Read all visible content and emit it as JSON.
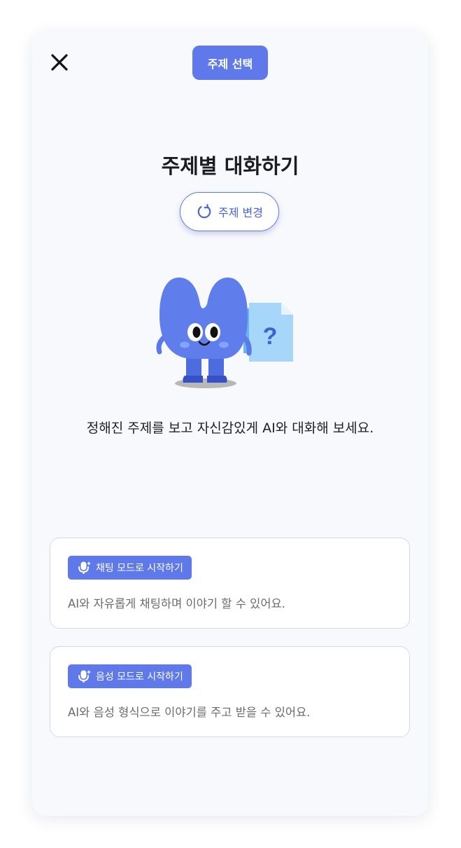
{
  "header": {
    "close_icon": "close-icon",
    "title": "주제 선택"
  },
  "main": {
    "title": "주제별 대화하기",
    "change_topic": {
      "label": "주제 변경",
      "icon": "refresh-icon"
    },
    "illustration": "mascot-with-question-document",
    "description": "정해진 주제를 보고 자신감있게 AI와 대화해 보세요."
  },
  "modes": [
    {
      "label": "채팅 모드로 시작하기",
      "icon": "mic-sparkle-icon",
      "description": "AI와 자유롭게 채팅하며 이야기 할 수 있어요."
    },
    {
      "label": "음성 모드로 시작하기",
      "icon": "mic-sparkle-icon",
      "description": "AI와 음성 형식으로 이야기를 주고 받을 수 있어요."
    }
  ],
  "colors": {
    "accent": "#5f79ea",
    "card_background": "#f8f9fd",
    "card_border": "#d1d9ef",
    "text_primary": "#1c1c1e",
    "text_secondary": "#6b6b6b"
  }
}
